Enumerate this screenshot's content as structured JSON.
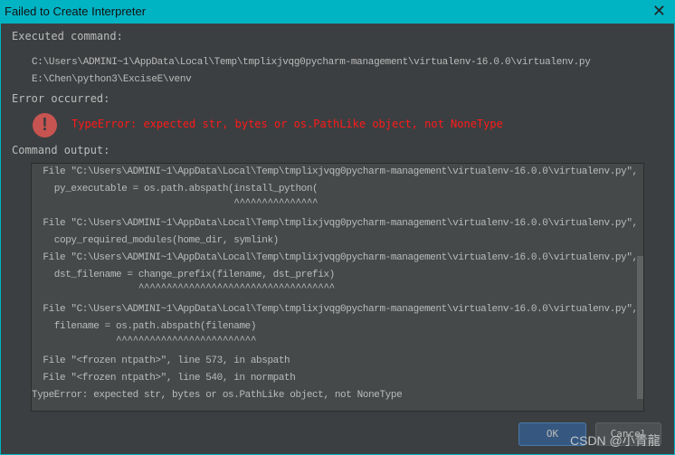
{
  "window": {
    "title": "Failed to Create Interpreter",
    "close_icon": "close-icon"
  },
  "executed": {
    "label": "Executed command:",
    "lines": [
      "C:\\Users\\ADMINI~1\\AppData\\Local\\Temp\\tmplixjvqg0pycharm-management\\virtualenv-16.0.0\\virtualenv.py",
      "E:\\Chen\\python3\\ExciseE\\venv"
    ]
  },
  "error": {
    "label": "Error occurred:",
    "icon": "error-icon",
    "message": "TypeError: expected str, bytes or os.PathLike object, not NoneType",
    "color": "#ff1a1a"
  },
  "output": {
    "label": "Command output:",
    "lines": [
      "  File \"C:\\Users\\ADMINI~1\\AppData\\Local\\Temp\\tmplixjvqg0pycharm-management\\virtualenv-16.0.0\\virtualenv.py\", line",
      "    py_executable = os.path.abspath(install_python(",
      "                                    ^^^^^^^^^^^^^^^",
      "  File \"C:\\Users\\ADMINI~1\\AppData\\Local\\Temp\\tmplixjvqg0pycharm-management\\virtualenv-16.0.0\\virtualenv.py\", line",
      "    copy_required_modules(home_dir, symlink)",
      "  File \"C:\\Users\\ADMINI~1\\AppData\\Local\\Temp\\tmplixjvqg0pycharm-management\\virtualenv-16.0.0\\virtualenv.py\", line",
      "    dst_filename = change_prefix(filename, dst_prefix)",
      "                   ^^^^^^^^^^^^^^^^^^^^^^^^^^^^^^^^^^^",
      "  File \"C:\\Users\\ADMINI~1\\AppData\\Local\\Temp\\tmplixjvqg0pycharm-management\\virtualenv-16.0.0\\virtualenv.py\", line",
      "    filename = os.path.abspath(filename)",
      "               ^^^^^^^^^^^^^^^^^^^^^^^^^",
      "  File \"<frozen ntpath>\", line 573, in abspath",
      "  File \"<frozen ntpath>\", line 540, in normpath",
      "TypeError: expected str, bytes or os.PathLike object, not NoneType"
    ]
  },
  "buttons": {
    "ok": "OK",
    "cancel": "Cancel"
  },
  "watermark": "CSDN @小青龍"
}
